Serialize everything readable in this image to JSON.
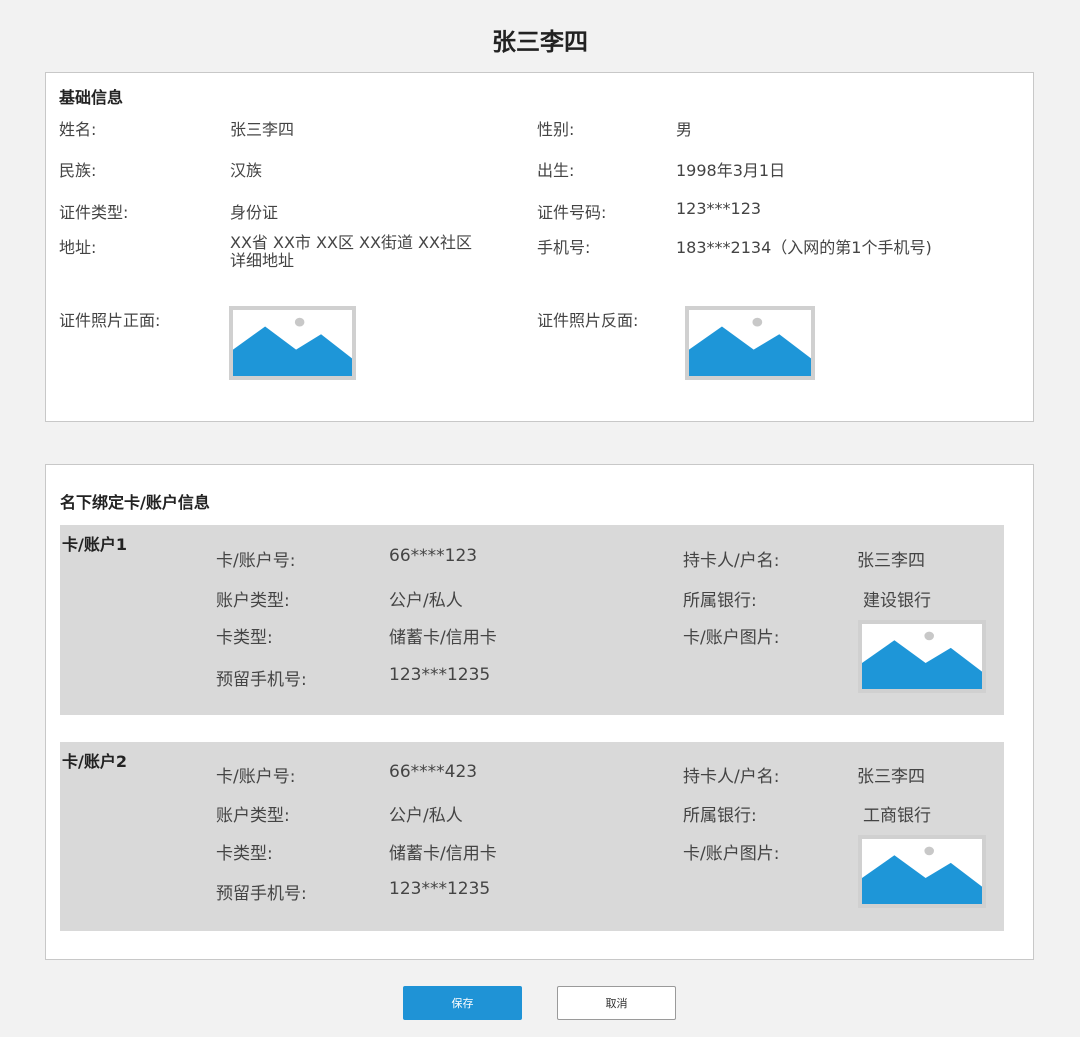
{
  "title": "张三李四",
  "basic": {
    "section_title": "基础信息",
    "name_label": "姓名:",
    "name_value": "张三李四",
    "gender_label": "性别:",
    "gender_value": "男",
    "ethnic_label": "民族:",
    "ethnic_value": "汉族",
    "birth_label": "出生:",
    "birth_value": "1998年3月1日",
    "id_type_label": "证件类型:",
    "id_type_value": "身份证",
    "id_no_label": "证件号码:",
    "id_no_value": "123***123",
    "address_label": "地址:",
    "address_value": "XX省 XX市 XX区 XX街道 XX社区 详细地址",
    "phone_label": "手机号:",
    "phone_value": "183***2134（入网的第1个手机号)",
    "photo_front_label": "证件照片正面:",
    "photo_back_label": "证件照片反面:"
  },
  "binding": {
    "section_title": "名下绑定卡/账户信息",
    "cards": [
      {
        "title": "卡/账户1",
        "card_no_label": "卡/账户号:",
        "card_no": "66****123",
        "holder_label": "持卡人/户名:",
        "holder": "张三李四",
        "acct_type_label": "账户类型:",
        "acct_type": "公户/私人",
        "bank_label": "所属银行:",
        "bank": "建设银行",
        "card_type_label": "卡类型:",
        "card_type": "储蓄卡/信用卡",
        "image_label": "卡/账户图片:",
        "phone_label": "预留手机号:",
        "phone": "123***1235"
      },
      {
        "title": "卡/账户2",
        "card_no_label": "卡/账户号:",
        "card_no": "66****423",
        "holder_label": "持卡人/户名:",
        "holder": "张三李四",
        "acct_type_label": "账户类型:",
        "acct_type": "公户/私人",
        "bank_label": "所属银行:",
        "bank": "工商银行",
        "card_type_label": "卡类型:",
        "card_type": "储蓄卡/信用卡",
        "image_label": "卡/账户图片:",
        "phone_label": "预留手机号:",
        "phone": "123***1235"
      }
    ]
  },
  "buttons": {
    "save": "保存",
    "cancel": "取消"
  },
  "colors": {
    "accent": "#1f93d6",
    "card_bg": "#d9d9d9",
    "image_blue": "#1e96d8"
  },
  "icons": {
    "photo_placeholder": "image-placeholder-icon"
  }
}
